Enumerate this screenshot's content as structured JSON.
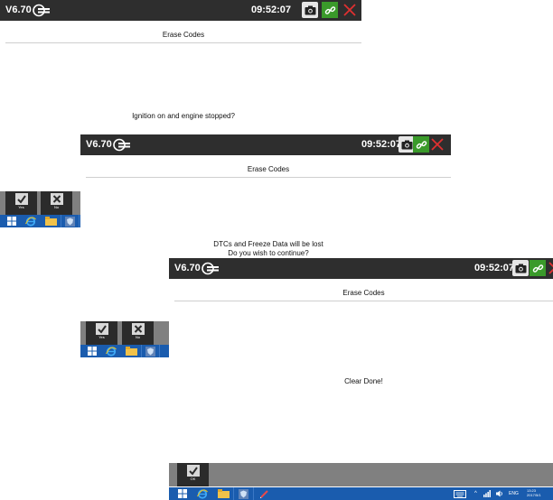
{
  "app": {
    "version": "V6.70",
    "time": "09:52:07"
  },
  "header_title": "Erase Codes",
  "screen1": {
    "message": "Ignition on and engine stopped?",
    "yes_label": "Yes",
    "no_label": "No"
  },
  "screen2": {
    "message_line1": "DTCs and Freeze Data will be lost",
    "message_line2": "Do you wish to continue?",
    "yes_label": "Yes",
    "no_label": "No"
  },
  "screen3": {
    "message": "Clear Done!",
    "ok_label": "OK"
  },
  "taskbar": {
    "language": "ENG",
    "clock_time": "13:23",
    "clock_date": "2017/5/1"
  },
  "colors": {
    "titlebar": "#2e2e2e",
    "link_button": "#3a9a2a",
    "close_icon": "#e03030",
    "taskbar": "#1a5cae",
    "action_bar": "#808080",
    "action_button": "#2b2b2b"
  },
  "icons": [
    "launch-logo-icon",
    "camera-icon",
    "link-icon",
    "close-icon",
    "check-icon",
    "x-icon",
    "windows-icon",
    "ie-icon",
    "folder-icon",
    "shield-icon",
    "pen-icon",
    "keyboard-icon",
    "network-icon",
    "volume-icon"
  ]
}
